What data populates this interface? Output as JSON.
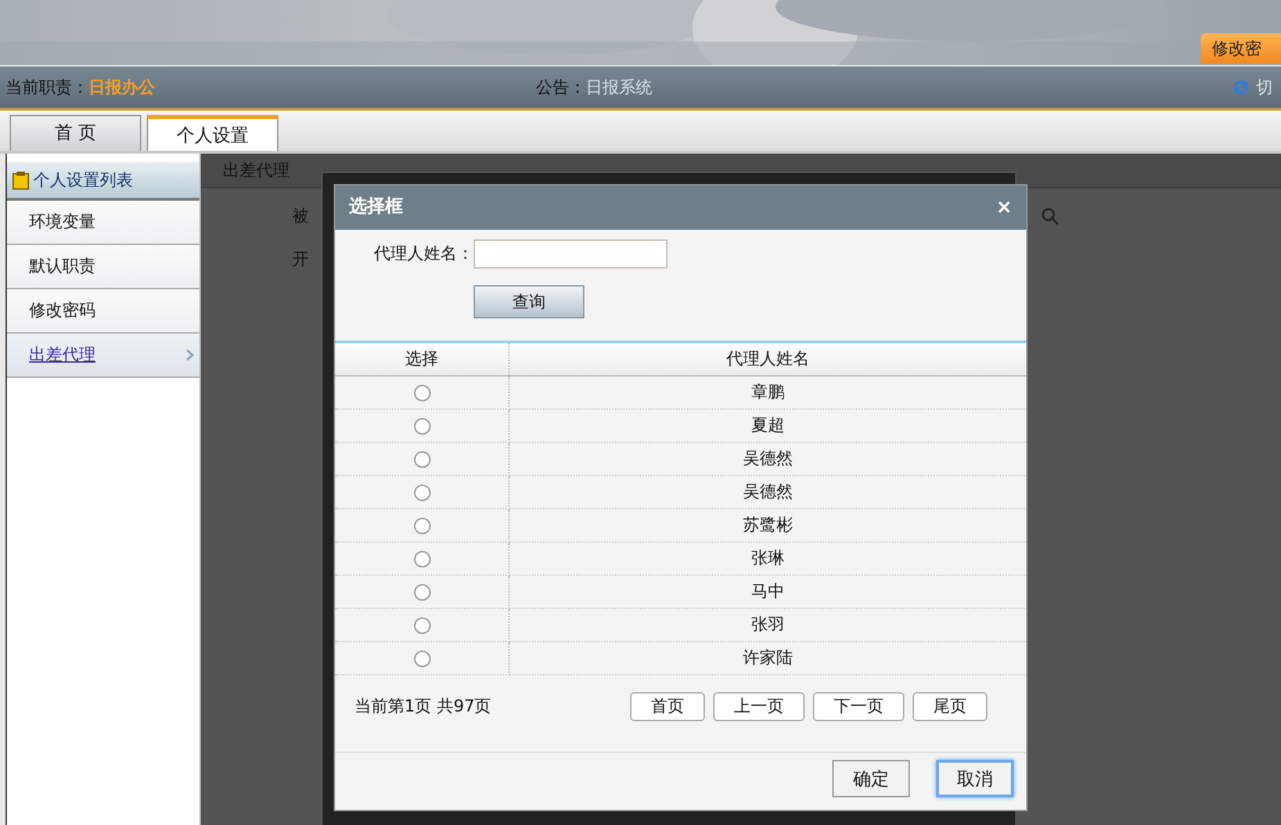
{
  "header": {
    "corner_tab": "修改密"
  },
  "info_bar": {
    "duty_label": "当前职责：",
    "duty_value": "日报办公",
    "notice_label": "公告：",
    "notice_value": "日报系统",
    "switch_label": "切"
  },
  "tabs": [
    {
      "label": "首 页",
      "selected": false
    },
    {
      "label": "个人设置",
      "selected": true
    }
  ],
  "sidebar": {
    "title": "个人设置列表",
    "items": [
      {
        "label": "环境变量",
        "selected": false
      },
      {
        "label": "默认职责",
        "selected": false
      },
      {
        "label": "修改密码",
        "selected": false
      },
      {
        "label": "出差代理",
        "selected": true
      }
    ]
  },
  "content": {
    "title": "出差代理",
    "form_labels": [
      "被",
      "开"
    ]
  },
  "dialog": {
    "title": "选择框",
    "close": "×",
    "search_label": "代理人姓名：",
    "search_button": "查询",
    "columns": [
      "选择",
      "代理人姓名"
    ],
    "rows": [
      {
        "name": "章鹏",
        "selected": false
      },
      {
        "name": "夏超",
        "selected": false
      },
      {
        "name": "吴德然",
        "selected": false
      },
      {
        "name": "吴德然",
        "selected": false
      },
      {
        "name": "苏鹭彬",
        "selected": false
      },
      {
        "name": "张琳",
        "selected": false
      },
      {
        "name": "马中",
        "selected": false
      },
      {
        "name": "张羽",
        "selected": false
      },
      {
        "name": "许家陆",
        "selected": false
      }
    ],
    "page_info": "当前第1页 共97页",
    "pager": [
      "首页",
      "上一页",
      "下一页",
      "尾页"
    ],
    "buttons": [
      {
        "label": "确定",
        "focused": false
      },
      {
        "label": "取消",
        "focused": true
      }
    ]
  }
}
